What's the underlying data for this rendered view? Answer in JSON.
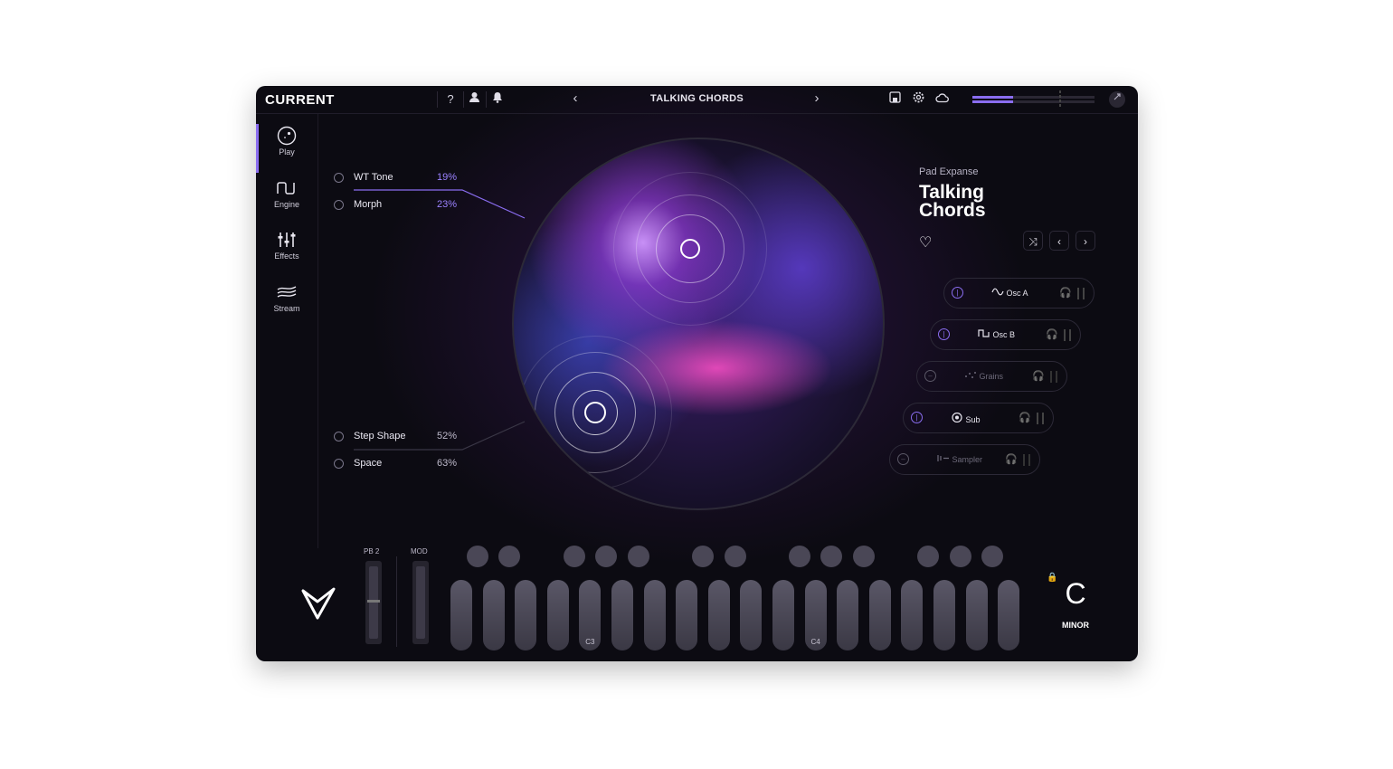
{
  "app": {
    "name": "CURRENT",
    "top_icons": [
      "help-icon",
      "user-icon",
      "bell-icon"
    ],
    "preset_title": "TALKING CHORDS",
    "right_icons": [
      "save-icon",
      "settings-icon",
      "cloud-icon"
    ],
    "help_glyph": "?",
    "prev_glyph": "‹",
    "next_glyph": "›",
    "output_level": 0.33
  },
  "sidebar": {
    "items": [
      {
        "label": "Play",
        "icon": "play-dial-icon",
        "active": true
      },
      {
        "label": "Engine",
        "icon": "waveform-icon",
        "active": false
      },
      {
        "label": "Effects",
        "icon": "sliders-icon",
        "active": false
      },
      {
        "label": "Stream",
        "icon": "stream-icon",
        "active": false
      }
    ]
  },
  "params": {
    "top": [
      {
        "name": "WT Tone",
        "value": "19%",
        "accent": true
      },
      {
        "name": "Morph",
        "value": "23%",
        "accent": true
      }
    ],
    "bottom": [
      {
        "name": "Step Shape",
        "value": "52%",
        "accent": false
      },
      {
        "name": "Space",
        "value": "63%",
        "accent": false
      }
    ]
  },
  "preset": {
    "category": "Pad Expanse",
    "name_line1": "Talking",
    "name_line2": "Chords",
    "heart_glyph": "♡",
    "shuffle_glyph": "⤨",
    "prev_glyph": "‹",
    "next_glyph": "›"
  },
  "layers": [
    {
      "name": "Osc A",
      "icon": "sine-wave-icon",
      "enabled": true
    },
    {
      "name": "Osc B",
      "icon": "square-wave-icon",
      "enabled": true
    },
    {
      "name": "Grains",
      "icon": "grains-icon",
      "enabled": false
    },
    {
      "name": "Sub",
      "icon": "sub-icon",
      "enabled": true
    },
    {
      "name": "Sampler",
      "icon": "sampler-icon",
      "enabled": false
    }
  ],
  "keyboard": {
    "pb_label": "PB 2",
    "mod_label": "MOD",
    "white_key_count": 18,
    "black_keys_by_gap": [
      1,
      1,
      0,
      1,
      1,
      1,
      0,
      1,
      1,
      0,
      1,
      1,
      1,
      0,
      1,
      1,
      1
    ],
    "labels": {
      "4": "C3",
      "11": "C4"
    },
    "key": "C",
    "scale": "MINOR",
    "lock_glyph": "🔒"
  },
  "colors": {
    "accent": "#8a6df0",
    "accent_text": "#9b82ff",
    "background": "#0c0b12"
  }
}
